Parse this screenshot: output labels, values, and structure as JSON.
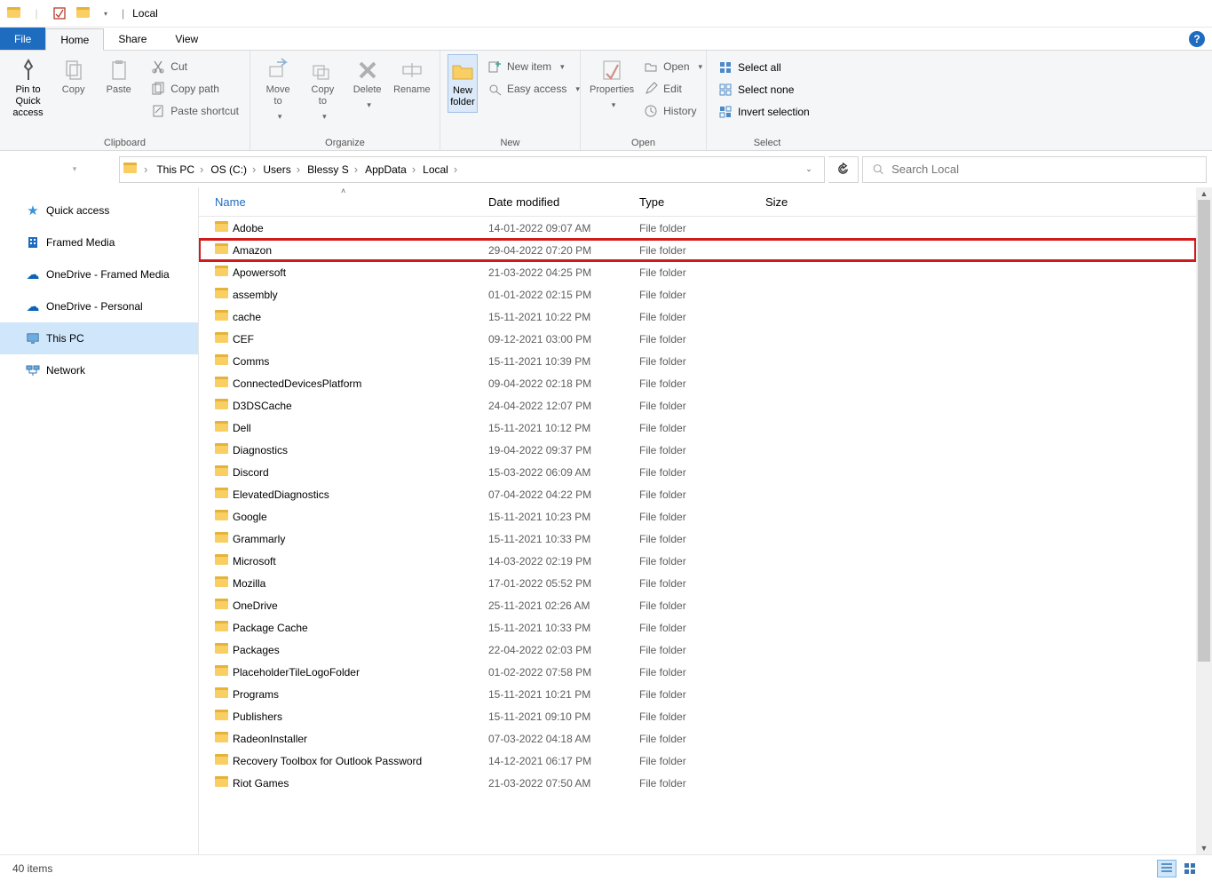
{
  "title": "Local",
  "ribbon_tabs": {
    "file": "File",
    "home": "Home",
    "share": "Share",
    "view": "View"
  },
  "ribbon": {
    "clipboard": {
      "label": "Clipboard",
      "pin": "Pin to Quick\naccess",
      "copy": "Copy",
      "paste": "Paste",
      "cut": "Cut",
      "copy_path": "Copy path",
      "paste_shortcut": "Paste shortcut"
    },
    "organize": {
      "label": "Organize",
      "move_to": "Move\nto",
      "copy_to": "Copy\nto",
      "delete": "Delete",
      "rename": "Rename"
    },
    "new": {
      "label": "New",
      "new_folder": "New\nfolder",
      "new_item": "New item",
      "easy_access": "Easy access"
    },
    "open": {
      "label": "Open",
      "properties": "Properties",
      "open": "Open",
      "edit": "Edit",
      "history": "History"
    },
    "select": {
      "label": "Select",
      "select_all": "Select all",
      "select_none": "Select none",
      "invert": "Invert selection"
    }
  },
  "breadcrumbs": [
    "This PC",
    "OS (C:)",
    "Users",
    "Blessy S",
    "AppData",
    "Local"
  ],
  "search_placeholder": "Search Local",
  "tree": {
    "quick_access": "Quick access",
    "framed_media": "Framed Media",
    "onedrive_framed": "OneDrive - Framed Media",
    "onedrive_personal": "OneDrive - Personal",
    "this_pc": "This PC",
    "network": "Network"
  },
  "columns": {
    "name": "Name",
    "date": "Date modified",
    "type": "Type",
    "size": "Size"
  },
  "rows": [
    {
      "name": "Adobe",
      "date": "14-01-2022 09:07 AM",
      "type": "File folder"
    },
    {
      "name": "Amazon",
      "date": "29-04-2022 07:20 PM",
      "type": "File folder",
      "highlight": true
    },
    {
      "name": "Apowersoft",
      "date": "21-03-2022 04:25 PM",
      "type": "File folder"
    },
    {
      "name": "assembly",
      "date": "01-01-2022 02:15 PM",
      "type": "File folder"
    },
    {
      "name": "cache",
      "date": "15-11-2021 10:22 PM",
      "type": "File folder"
    },
    {
      "name": "CEF",
      "date": "09-12-2021 03:00 PM",
      "type": "File folder"
    },
    {
      "name": "Comms",
      "date": "15-11-2021 10:39 PM",
      "type": "File folder"
    },
    {
      "name": "ConnectedDevicesPlatform",
      "date": "09-04-2022 02:18 PM",
      "type": "File folder"
    },
    {
      "name": "D3DSCache",
      "date": "24-04-2022 12:07 PM",
      "type": "File folder"
    },
    {
      "name": "Dell",
      "date": "15-11-2021 10:12 PM",
      "type": "File folder"
    },
    {
      "name": "Diagnostics",
      "date": "19-04-2022 09:37 PM",
      "type": "File folder"
    },
    {
      "name": "Discord",
      "date": "15-03-2022 06:09 AM",
      "type": "File folder"
    },
    {
      "name": "ElevatedDiagnostics",
      "date": "07-04-2022 04:22 PM",
      "type": "File folder"
    },
    {
      "name": "Google",
      "date": "15-11-2021 10:23 PM",
      "type": "File folder"
    },
    {
      "name": "Grammarly",
      "date": "15-11-2021 10:33 PM",
      "type": "File folder"
    },
    {
      "name": "Microsoft",
      "date": "14-03-2022 02:19 PM",
      "type": "File folder"
    },
    {
      "name": "Mozilla",
      "date": "17-01-2022 05:52 PM",
      "type": "File folder"
    },
    {
      "name": "OneDrive",
      "date": "25-11-2021 02:26 AM",
      "type": "File folder"
    },
    {
      "name": "Package Cache",
      "date": "15-11-2021 10:33 PM",
      "type": "File folder"
    },
    {
      "name": "Packages",
      "date": "22-04-2022 02:03 PM",
      "type": "File folder"
    },
    {
      "name": "PlaceholderTileLogoFolder",
      "date": "01-02-2022 07:58 PM",
      "type": "File folder"
    },
    {
      "name": "Programs",
      "date": "15-11-2021 10:21 PM",
      "type": "File folder"
    },
    {
      "name": "Publishers",
      "date": "15-11-2021 09:10 PM",
      "type": "File folder"
    },
    {
      "name": "RadeonInstaller",
      "date": "07-03-2022 04:18 AM",
      "type": "File folder"
    },
    {
      "name": "Recovery Toolbox for Outlook Password",
      "date": "14-12-2021 06:17 PM",
      "type": "File folder"
    },
    {
      "name": "Riot Games",
      "date": "21-03-2022 07:50 AM",
      "type": "File folder"
    }
  ],
  "status": {
    "items": "40 items"
  }
}
